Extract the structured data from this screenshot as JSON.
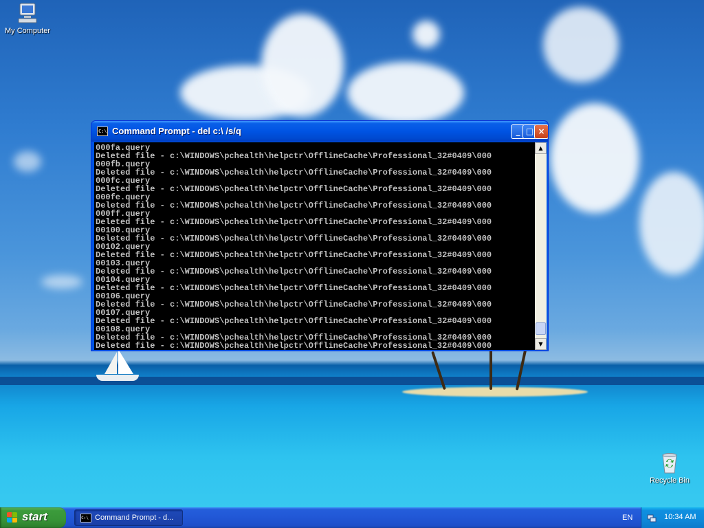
{
  "desktop": {
    "icons": [
      {
        "label": "My Computer",
        "icon": "computer-icon"
      },
      {
        "label": "Recycle Bin",
        "icon": "recycle-bin-icon"
      }
    ]
  },
  "window": {
    "title": "Command Prompt - del c:\\ /s/q",
    "icon": "console-icon",
    "controls": {
      "minimize": "_",
      "maximize": "□",
      "close": "×"
    },
    "console_lines": [
      "000fa.query",
      "Deleted file - c:\\WINDOWS\\pchealth\\helpctr\\OfflineCache\\Professional_32#0409\\000",
      "000fb.query",
      "Deleted file - c:\\WINDOWS\\pchealth\\helpctr\\OfflineCache\\Professional_32#0409\\000",
      "000fc.query",
      "Deleted file - c:\\WINDOWS\\pchealth\\helpctr\\OfflineCache\\Professional_32#0409\\000",
      "000fe.query",
      "Deleted file - c:\\WINDOWS\\pchealth\\helpctr\\OfflineCache\\Professional_32#0409\\000",
      "000ff.query",
      "Deleted file - c:\\WINDOWS\\pchealth\\helpctr\\OfflineCache\\Professional_32#0409\\000",
      "00100.query",
      "Deleted file - c:\\WINDOWS\\pchealth\\helpctr\\OfflineCache\\Professional_32#0409\\000",
      "00102.query",
      "Deleted file - c:\\WINDOWS\\pchealth\\helpctr\\OfflineCache\\Professional_32#0409\\000",
      "00103.query",
      "Deleted file - c:\\WINDOWS\\pchealth\\helpctr\\OfflineCache\\Professional_32#0409\\000",
      "00104.query",
      "Deleted file - c:\\WINDOWS\\pchealth\\helpctr\\OfflineCache\\Professional_32#0409\\000",
      "00106.query",
      "Deleted file - c:\\WINDOWS\\pchealth\\helpctr\\OfflineCache\\Professional_32#0409\\000",
      "00107.query",
      "Deleted file - c:\\WINDOWS\\pchealth\\helpctr\\OfflineCache\\Professional_32#0409\\000",
      "00108.query",
      "Deleted file - c:\\WINDOWS\\pchealth\\helpctr\\OfflineCache\\Professional_32#0409\\000",
      "Deleted file - c:\\WINDOWS\\pchealth\\helpctr\\OfflineCache\\Professional_32#0409\\000"
    ],
    "scrollbar_position": 0.98
  },
  "taskbar": {
    "start_label": "start",
    "tasks": [
      {
        "label": "Command Prompt - d...",
        "icon": "console-icon"
      }
    ],
    "language": "EN",
    "clock": "10:34 AM",
    "tray_icon": "network-icon"
  }
}
